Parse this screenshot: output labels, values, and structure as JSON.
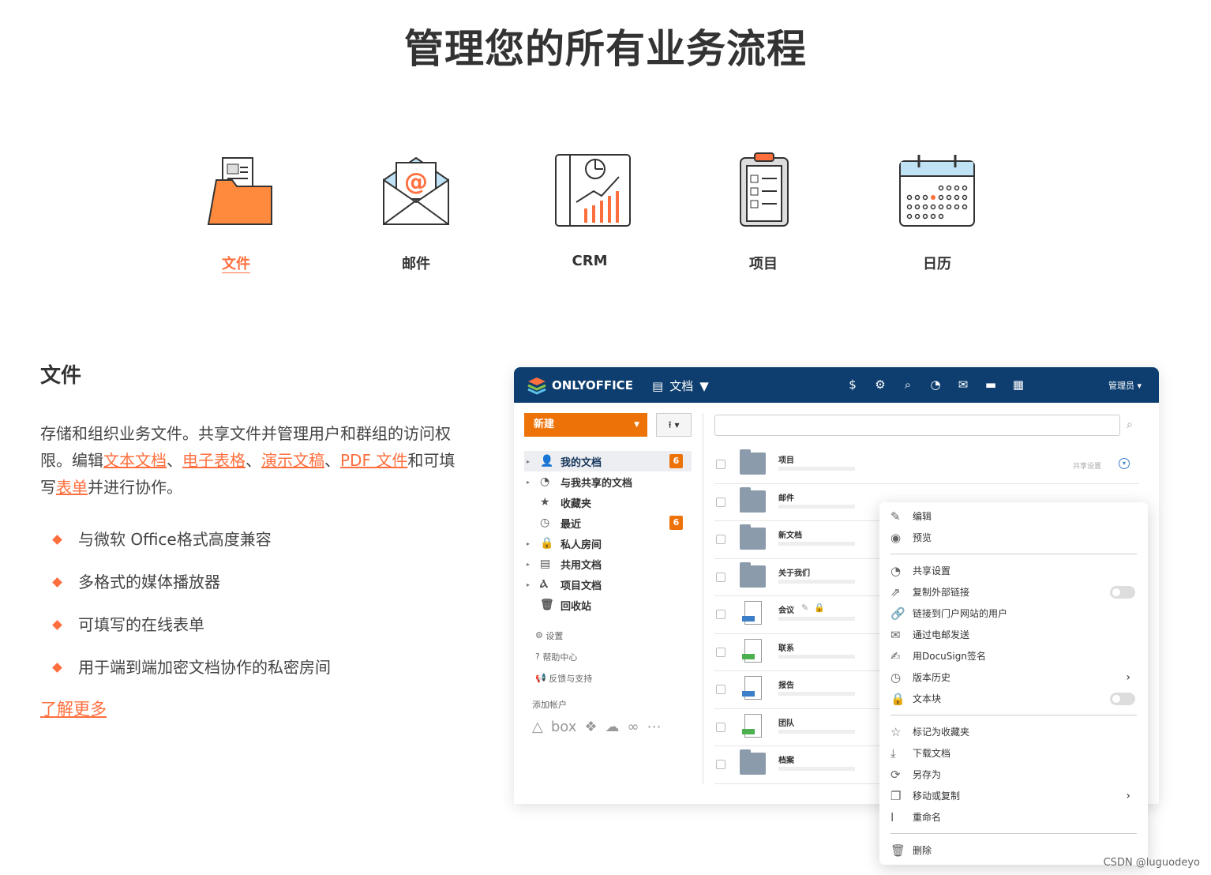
{
  "title": "管理您的所有业务流程",
  "tabs": [
    "文件",
    "邮件",
    "CRM",
    "项目",
    "日历"
  ],
  "section": {
    "heading": "文件",
    "desc_a": "存储和组织业务文件。共享文件并管理用户和群组的访问权限。编辑",
    "link_text": "文本文档",
    "sep1": "、",
    "link_sheet": "电子表格",
    "sep2": "、",
    "link_slide": "演示文稿",
    "sep3": "、",
    "link_pdf": "PDF 文件",
    "desc_b": "和可填写",
    "link_form": "表单",
    "desc_c": "并进行协作。",
    "features": [
      "与微软 Office格式高度兼容",
      "多格式的媒体播放器",
      "可填写的在线表单",
      "用于端到端加密文档协作的私密房间"
    ],
    "more": "了解更多"
  },
  "app": {
    "logo": "ONLYOFFICE",
    "module": "文档",
    "admin": "管理员 ▾",
    "new_btn": "新建",
    "tree": [
      {
        "label": "我的文档",
        "badge": "6"
      },
      {
        "label": "与我共享的文档"
      },
      {
        "label": "收藏夹"
      },
      {
        "label": "最近",
        "badge": "6"
      },
      {
        "label": "私人房间"
      },
      {
        "label": "共用文档"
      },
      {
        "label": "项目文档"
      },
      {
        "label": "回收站"
      }
    ],
    "tree2": [
      "设置",
      "帮助中心",
      "反馈与支持"
    ],
    "add_account": "添加帐户",
    "cloud_box": "box",
    "rows": [
      "项目",
      "邮件",
      "新文档",
      "关于我们",
      "会议",
      "联系",
      "报告",
      "团队",
      "档案"
    ],
    "row_meta": "共享设置",
    "menu": [
      "编辑",
      "预览",
      "共享设置",
      "复制外部链接",
      "链接到门户网站的用户",
      "通过电邮发送",
      "用DocuSign签名",
      "版本历史",
      "文本块",
      "标记为收藏夹",
      "下载文档",
      "另存为",
      "移动或复制",
      "重命名",
      "删除"
    ]
  },
  "watermark": "CSDN @luguodeyo"
}
